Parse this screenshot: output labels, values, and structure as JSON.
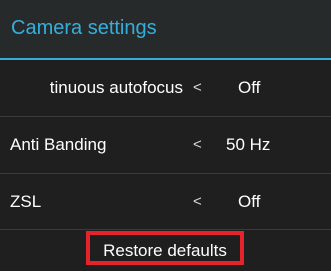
{
  "header": {
    "title": "Camera settings"
  },
  "settings": [
    {
      "label": "tinuous autofocus",
      "value": "Off",
      "chevron": "<"
    },
    {
      "label": "Anti Banding",
      "value": "50 Hz",
      "chevron": "<"
    },
    {
      "label": "ZSL",
      "value": "Off",
      "chevron": "<"
    }
  ],
  "footer": {
    "restore_label": "Restore defaults"
  },
  "colors": {
    "accent": "#35aedc",
    "highlight_border": "#e3242b",
    "background": "#1f1f1f"
  }
}
